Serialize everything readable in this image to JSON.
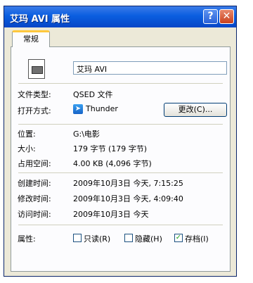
{
  "window": {
    "title": "艾玛 AVI 属性",
    "help_button": "?",
    "close_button": "✕"
  },
  "tabs": {
    "general": "常规"
  },
  "file": {
    "name": "艾玛 AVI",
    "type_label": "文件类型:",
    "type_value": "QSED 文件",
    "open_with_label": "打开方式:",
    "open_with_app": "Thunder",
    "change_button": "更改(C)..."
  },
  "location": {
    "location_label": "位置:",
    "location_value": "G:\\电影",
    "size_label": "大小:",
    "size_value": "179 字节 (179 字节)",
    "disk_size_label": "占用空间:",
    "disk_size_value": "4.00 KB (4,096 字节)"
  },
  "times": {
    "created_label": "创建时间:",
    "created_value": "2009年10月3日 今天, 7:15:25",
    "modified_label": "修改时间:",
    "modified_value": "2009年10月3日 今天, 4:09:40",
    "accessed_label": "访问时间:",
    "accessed_value": "2009年10月3日 今天"
  },
  "attributes": {
    "label": "属性:",
    "readonly": {
      "label": "只读(R)",
      "checked": false
    },
    "hidden": {
      "label": "隐藏(H)",
      "checked": false
    },
    "archive": {
      "label": "存档(I)",
      "checked": true
    },
    "check_mark": "✓"
  }
}
